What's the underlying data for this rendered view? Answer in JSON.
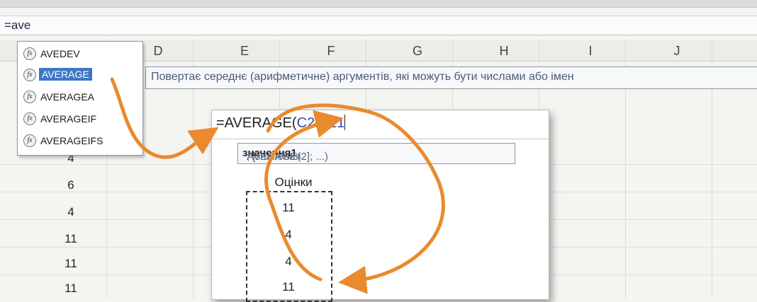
{
  "formula_bar": {
    "text": "=ave"
  },
  "columns": [
    "D",
    "E",
    "F",
    "G",
    "H",
    "I",
    "J"
  ],
  "sheet_values": [
    "4",
    "6",
    "4",
    "11",
    "11",
    "11"
  ],
  "autocomplete": {
    "items": [
      {
        "label": "AVEDEV",
        "selected": false
      },
      {
        "label": "AVERAGE",
        "selected": true
      },
      {
        "label": "AVERAGEA",
        "selected": false
      },
      {
        "label": "AVERAGEIF",
        "selected": false
      },
      {
        "label": "AVERAGEIFS",
        "selected": false
      }
    ],
    "icon": "function-icon"
  },
  "tooltip": {
    "text": "Повертає середнє (арифметичне) аргументів, які можуть бути числами або імен"
  },
  "popup": {
    "formula_prefix": "=AVERAGE(",
    "formula_ref": "C2:C21",
    "hint_prefix": "AVERAGE(",
    "hint_bold": "значення1",
    "hint_rest": "; [значення2]; ...)",
    "column_header": "Оцінки",
    "values": [
      "11",
      "4",
      "4",
      "11"
    ]
  },
  "colors": {
    "arrow": "#e98a2e",
    "selection": "#3d78c7",
    "ref": "#3a48b0"
  }
}
